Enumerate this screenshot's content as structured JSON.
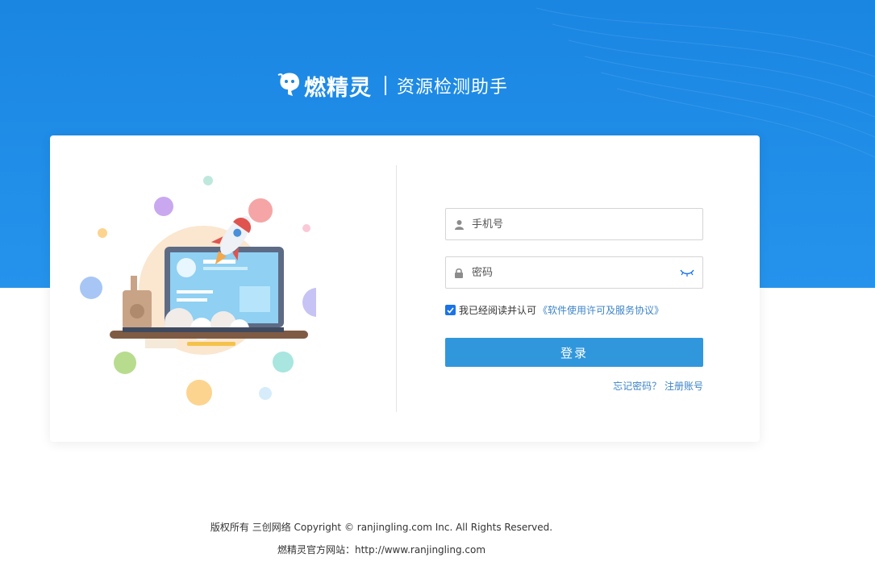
{
  "brand": {
    "name": "燃精灵",
    "subtitle": "资源检测助手",
    "mascot_icon": "mascot-logo-icon"
  },
  "colors": {
    "banner": "#1a86e2",
    "primary_button": "#3197dc",
    "link": "#3d84c8"
  },
  "login": {
    "phone_placeholder": "手机号",
    "password_placeholder": "密码",
    "agree_checked": true,
    "agree_text": "我已经阅读并认可",
    "agreement_link": "《软件使用许可及服务协议》",
    "submit_label": "登录",
    "forgot_label": "忘记密码？",
    "register_label": "注册账号"
  },
  "footer": {
    "copyright": "版权所有 三创网络 Copyright © ranjingling.com Inc. All Rights Reserved.",
    "website": "燃精灵官方网站：http://www.ranjingling.com"
  }
}
